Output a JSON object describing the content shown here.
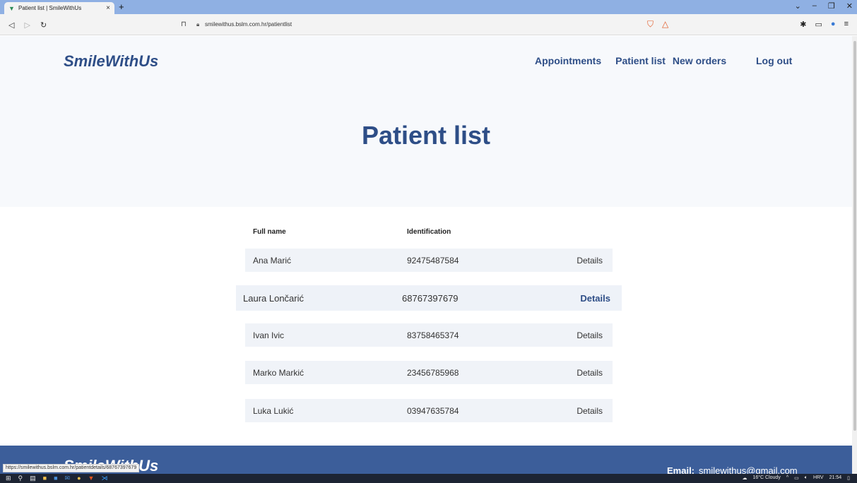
{
  "browser": {
    "tab_title": "Patient list | SmileWithUs",
    "tab_close": "×",
    "new_tab": "+",
    "url": "smilewithus.bslm.com.hr/patientlist",
    "status_url": "https://smilewithus.bslm.com.hr/patientdetails/68767397679"
  },
  "header": {
    "brand": "SmileWithUs",
    "nav": [
      "Appointments",
      "Patient list",
      "New orders"
    ],
    "logout": "Log out"
  },
  "main": {
    "title": "Patient list",
    "columns": [
      "Full name",
      "Identification"
    ],
    "rows": [
      {
        "name": "Ana Marić",
        "id": "92475487584",
        "action": "Details"
      },
      {
        "name": "Laura Lončarić",
        "id": "68767397679",
        "action": "Details"
      },
      {
        "name": "Ivan Ivic",
        "id": "83758465374",
        "action": "Details"
      },
      {
        "name": "Marko Markić",
        "id": "23456785968",
        "action": "Details"
      },
      {
        "name": "Luka Lukić",
        "id": "03947635784",
        "action": "Details"
      }
    ]
  },
  "footer": {
    "brand": "SmileWithUs",
    "email_label": "Email:",
    "email_value": "smilewithus@gmail.com"
  },
  "taskbar": {
    "weather": "16°C Cloudy",
    "lang": "HRV",
    "time": "21:54"
  },
  "colors": {
    "brand": "#2e4e87",
    "footer_bg": "#3c5e9a",
    "row_bg": "#f0f3f8"
  }
}
